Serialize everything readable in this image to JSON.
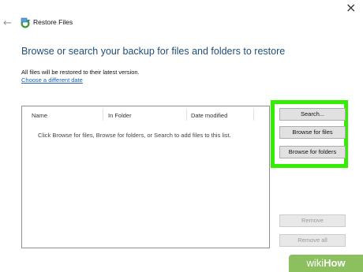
{
  "window": {
    "title": "Restore Files",
    "close_glyph": "×",
    "back_glyph": "←",
    "icon": "restore-files-icon"
  },
  "main": {
    "heading": "Browse or search your backup for files and folders to restore",
    "note": "All files will be restored to their latest version.",
    "change_date_link": "Choose a different date"
  },
  "file_list": {
    "columns": [
      "Name",
      "In Folder",
      "Date modified"
    ],
    "empty_message": "Click Browse for files, Browse for folders, or Search to add files to this list."
  },
  "buttons": {
    "search": "Search...",
    "browse_files": "Browse for files",
    "browse_folders": "Browse for folders",
    "remove": "Remove",
    "remove_all": "Remove all"
  },
  "watermark": {
    "prefix": "wiki",
    "suffix": "How"
  },
  "colors": {
    "highlight": "#33ee00",
    "heading": "#1f4e79",
    "link": "#1a5fb4",
    "watermark_bg": "#7fb84d"
  }
}
